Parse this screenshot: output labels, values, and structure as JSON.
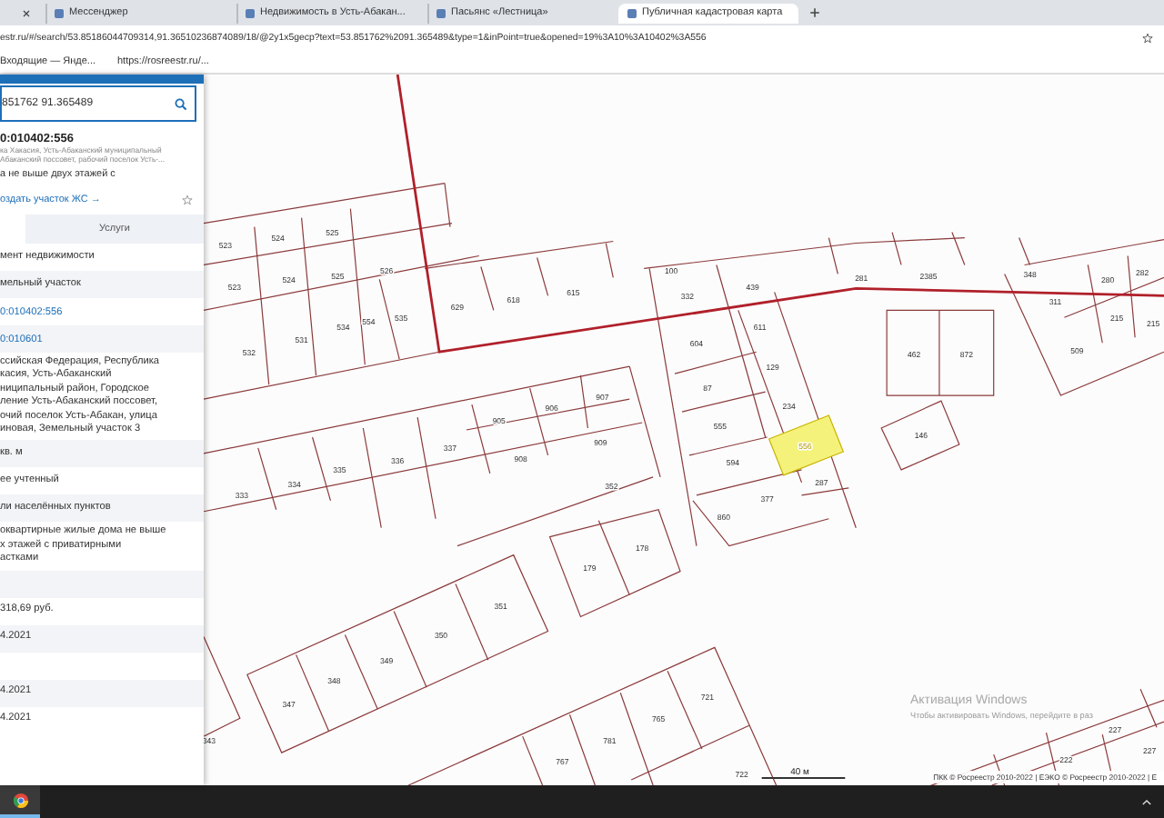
{
  "browser": {
    "tabs": [
      {
        "title": "Мессенджер",
        "selected": false
      },
      {
        "title": "Недвижимость в Усть-Абакан...",
        "selected": false
      },
      {
        "title": "Пасьянс «Лестница»",
        "selected": false
      },
      {
        "title": "Публичная кадастровая карта",
        "selected": true
      }
    ],
    "address": "estr.ru/#/search/53.85186044709314,91.36510236874089/18/@2y1x5gecp?text=53.851762%2091.365489&type=1&inPoint=true&opened=19%3A10%3A10402%3A556",
    "bookmarks": [
      "Входящие — Янде...",
      "https://rosreestr.ru/..."
    ]
  },
  "panel": {
    "search": {
      "value": "851762 91.365489"
    },
    "parcel_number": "0:010402:556",
    "address_lines": [
      "ка Хакасия, Усть-Абаканский муниципальный",
      "Абаканский поссовет, рабочий поселок Усть-..."
    ],
    "purpose": "а не выше двух этажей с",
    "create_link": "оздать участок ЖС →",
    "tabs": [
      {
        "label": "Услуги",
        "selected": false
      }
    ],
    "rows": [
      {
        "kind": "text",
        "lines": [
          "мент недвижимости"
        ]
      },
      {
        "kind": "text",
        "lines": [
          "мельный участок"
        ]
      },
      {
        "kind": "link",
        "lines": [
          "0:010402:556"
        ]
      },
      {
        "kind": "link",
        "lines": [
          "0:010601"
        ]
      },
      {
        "kind": "text",
        "lines": [
          "ссийская Федерация, Республика",
          "касия, Усть-Абаканский",
          "ниципальный район, Городское",
          "ление Усть-Абаканский поссовет,",
          "очий поселок Усть-Абакан, улица",
          "иновая, Земельный участок 3"
        ]
      },
      {
        "kind": "text",
        "lines": [
          "кв. м"
        ]
      },
      {
        "kind": "text",
        "lines": [
          "ее учтенный"
        ]
      },
      {
        "kind": "text",
        "lines": [
          "ли населённых пунктов"
        ]
      },
      {
        "kind": "text",
        "lines": [
          "оквартирные жилые дома не выше",
          "х этажей с приватирными",
          "астками"
        ]
      },
      {
        "kind": "empty"
      },
      {
        "kind": "text",
        "lines": [
          "318,69 руб."
        ]
      },
      {
        "kind": "text",
        "lines": [
          "4.2021"
        ]
      },
      {
        "kind": "empty"
      },
      {
        "kind": "text",
        "lines": [
          "4.2021"
        ]
      },
      {
        "kind": "text",
        "lines": [
          "4.2021"
        ]
      }
    ]
  },
  "map": {
    "parcels": [
      {
        "number": "523",
        "selected": false
      },
      {
        "number": "524",
        "selected": false
      },
      {
        "number": "525",
        "selected": false
      },
      {
        "number": "523",
        "selected": false
      },
      {
        "number": "524",
        "selected": false
      },
      {
        "number": "525",
        "selected": false
      },
      {
        "number": "526",
        "selected": false
      },
      {
        "number": "532",
        "selected": false
      },
      {
        "number": "531",
        "selected": false
      },
      {
        "number": "534",
        "selected": false
      },
      {
        "number": "554",
        "selected": false
      },
      {
        "number": "535",
        "selected": false
      },
      {
        "number": "629",
        "selected": false
      },
      {
        "number": "618",
        "selected": false
      },
      {
        "number": "615",
        "selected": false
      },
      {
        "number": "100",
        "selected": false
      },
      {
        "number": "332",
        "selected": false
      },
      {
        "number": "439",
        "selected": false
      },
      {
        "number": "281",
        "selected": false
      },
      {
        "number": "2385",
        "selected": false
      },
      {
        "number": "348",
        "selected": false
      },
      {
        "number": "280",
        "selected": false
      },
      {
        "number": "282",
        "selected": false
      },
      {
        "number": "311",
        "selected": false
      },
      {
        "number": "604",
        "selected": false
      },
      {
        "number": "611",
        "selected": false
      },
      {
        "number": "462",
        "selected": false
      },
      {
        "number": "872",
        "selected": false
      },
      {
        "number": "215",
        "selected": false
      },
      {
        "number": "215",
        "selected": false
      },
      {
        "number": "509",
        "selected": false
      },
      {
        "number": "129",
        "selected": false
      },
      {
        "number": "87",
        "selected": false
      },
      {
        "number": "907",
        "selected": false
      },
      {
        "number": "906",
        "selected": false
      },
      {
        "number": "905",
        "selected": false
      },
      {
        "number": "234",
        "selected": false
      },
      {
        "number": "909",
        "selected": false
      },
      {
        "number": "908",
        "selected": false
      },
      {
        "number": "337",
        "selected": false
      },
      {
        "number": "336",
        "selected": false
      },
      {
        "number": "335",
        "selected": false
      },
      {
        "number": "555",
        "selected": false
      },
      {
        "number": "556",
        "selected": true
      },
      {
        "number": "146",
        "selected": false
      },
      {
        "number": "594",
        "selected": false
      },
      {
        "number": "333",
        "selected": false
      },
      {
        "number": "334",
        "selected": false
      },
      {
        "number": "352",
        "selected": false
      },
      {
        "number": "377",
        "selected": false
      },
      {
        "number": "287",
        "selected": false
      },
      {
        "number": "860",
        "selected": false
      },
      {
        "number": "179",
        "selected": false
      },
      {
        "number": "178",
        "selected": false
      },
      {
        "number": "351",
        "selected": false
      },
      {
        "number": "350",
        "selected": false
      },
      {
        "number": "349",
        "selected": false
      },
      {
        "number": "348",
        "selected": false
      },
      {
        "number": "347",
        "selected": false
      },
      {
        "number": "343",
        "selected": false
      },
      {
        "number": "721",
        "selected": false
      },
      {
        "number": "765",
        "selected": false
      },
      {
        "number": "781",
        "selected": false
      },
      {
        "number": "767",
        "selected": false
      },
      {
        "number": "227",
        "selected": false
      },
      {
        "number": "222",
        "selected": false
      },
      {
        "number": "227",
        "selected": false
      },
      {
        "number": "722",
        "selected": false
      }
    ],
    "scale": "40 м",
    "attribution": "ПКК © Росреестр 2010-2022 | ЕЭКО © Росреестр 2010-2022 | Е"
  },
  "os": {
    "activation_title": "Активация Windows",
    "activation_text": "Чтобы активировать Windows, перейдите в раз"
  }
}
